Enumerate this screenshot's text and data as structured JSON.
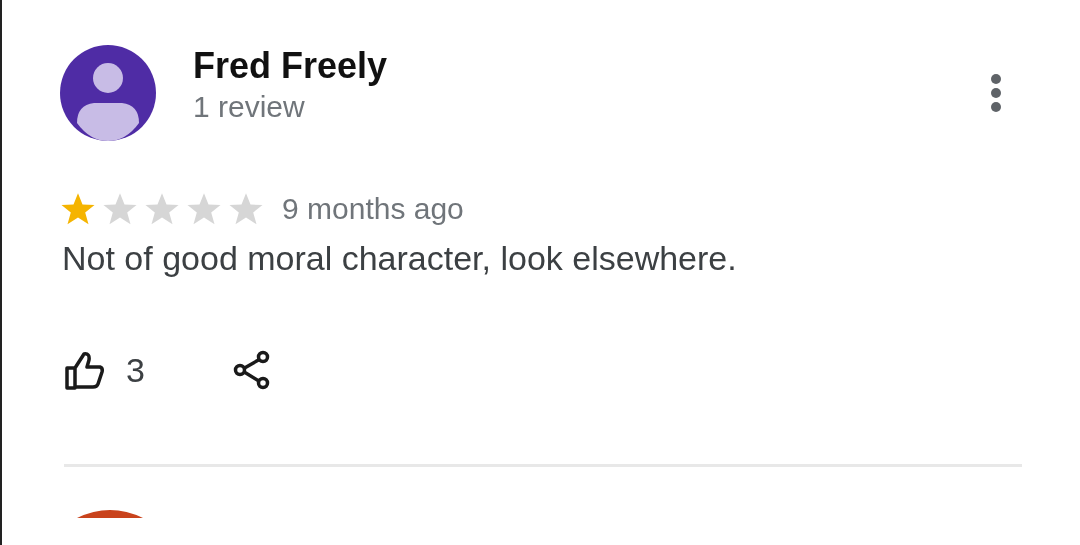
{
  "review": {
    "author": "Fred Freely",
    "author_meta": "1 review",
    "stars": 1,
    "time": "9 months ago",
    "text": "Not of good moral character, look elsewhere.",
    "likes": "3"
  }
}
